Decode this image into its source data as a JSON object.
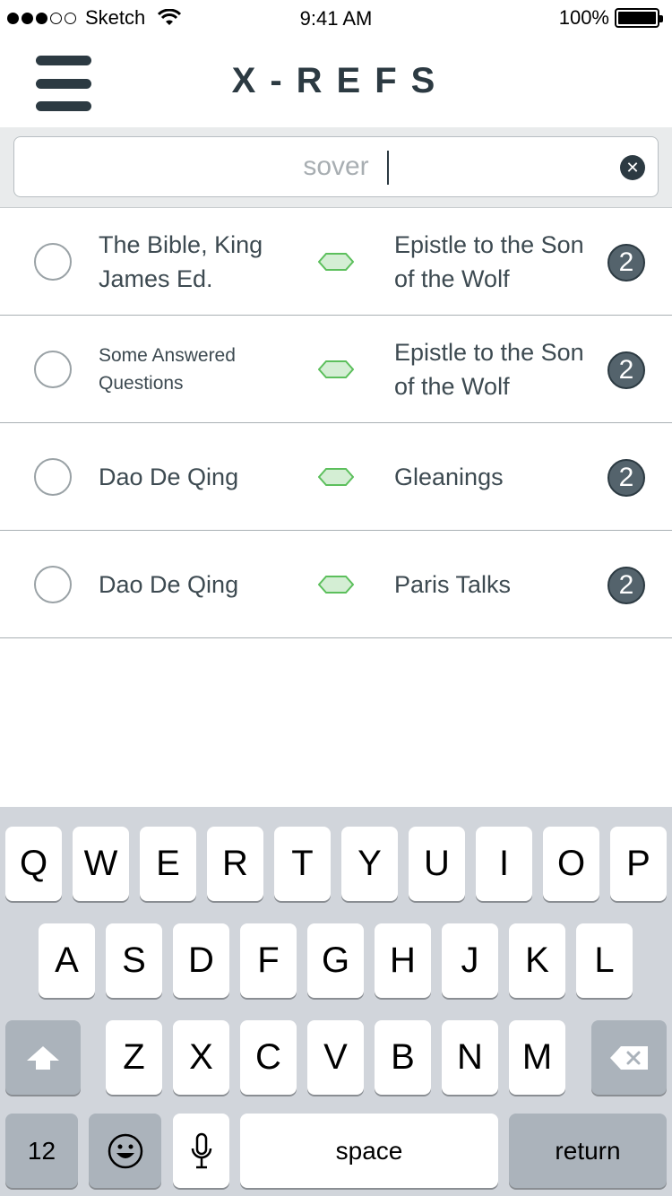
{
  "status_bar": {
    "carrier": "Sketch",
    "time": "9:41 AM",
    "battery": "100%"
  },
  "header": {
    "title": "X-REFS"
  },
  "search": {
    "value": "sover"
  },
  "results": [
    {
      "source": "The Bible, King James Ed.",
      "target": "Epistle to the Son of the Wolf",
      "count": "2"
    },
    {
      "source": "Some Answered Questions",
      "target": "Epistle to the Son of the Wolf",
      "count": "2"
    },
    {
      "source": "Dao De Qing",
      "target": "Gleanings",
      "count": "2"
    },
    {
      "source": "Dao De Qing",
      "target": "Paris Talks",
      "count": "2"
    }
  ],
  "keyboard": {
    "row1": [
      "Q",
      "W",
      "E",
      "R",
      "T",
      "Y",
      "U",
      "I",
      "O",
      "P"
    ],
    "row2": [
      "A",
      "S",
      "D",
      "F",
      "G",
      "H",
      "J",
      "K",
      "L"
    ],
    "row3": [
      "Z",
      "X",
      "C",
      "V",
      "B",
      "N",
      "M"
    ],
    "numbers_label": "12",
    "space_label": "space",
    "return_label": "return"
  },
  "colors": {
    "primary": "#2c3a42",
    "link_icon": "#5cbf5c",
    "link_fill": "#d4eed4",
    "badge": "#54636c"
  }
}
